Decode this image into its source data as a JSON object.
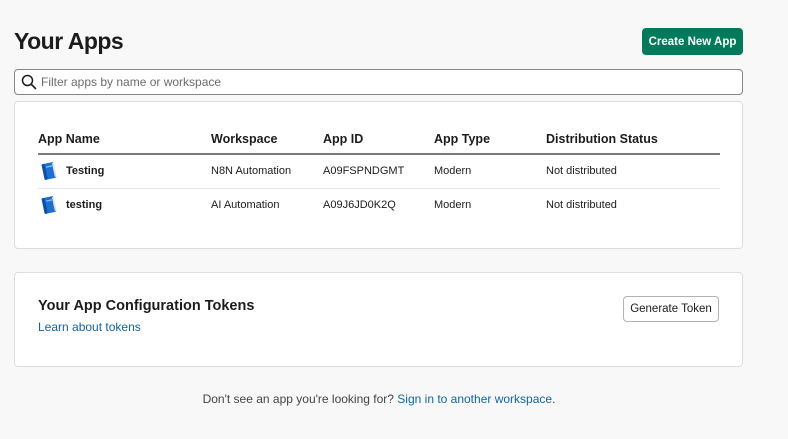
{
  "header": {
    "title": "Your Apps",
    "create_label": "Create New App"
  },
  "search": {
    "placeholder": "Filter apps by name or workspace",
    "value": "",
    "icon": "search-icon"
  },
  "apps_table": {
    "columns": [
      "App Name",
      "Workspace",
      "App ID",
      "App Type",
      "Distribution Status"
    ],
    "rows": [
      {
        "icon": "app-book-icon",
        "name": "Testing",
        "workspace": "N8N Automation",
        "app_id": "A09FSPNDGMT",
        "type": "Modern",
        "status": "Not distributed"
      },
      {
        "icon": "app-book-icon",
        "name": "testing",
        "workspace": "AI Automation",
        "app_id": "A09J6JD0K2Q",
        "type": "Modern",
        "status": "Not distributed"
      }
    ]
  },
  "tokens": {
    "title": "Your App Configuration Tokens",
    "learn_link": "Learn about tokens",
    "generate_label": "Generate Token"
  },
  "footer": {
    "text": "Don't see an app you're looking for?",
    "link": "Sign in to another workspace",
    "suffix": "."
  },
  "colors": {
    "primary_button": "#007a5a",
    "link": "#1264a3"
  }
}
